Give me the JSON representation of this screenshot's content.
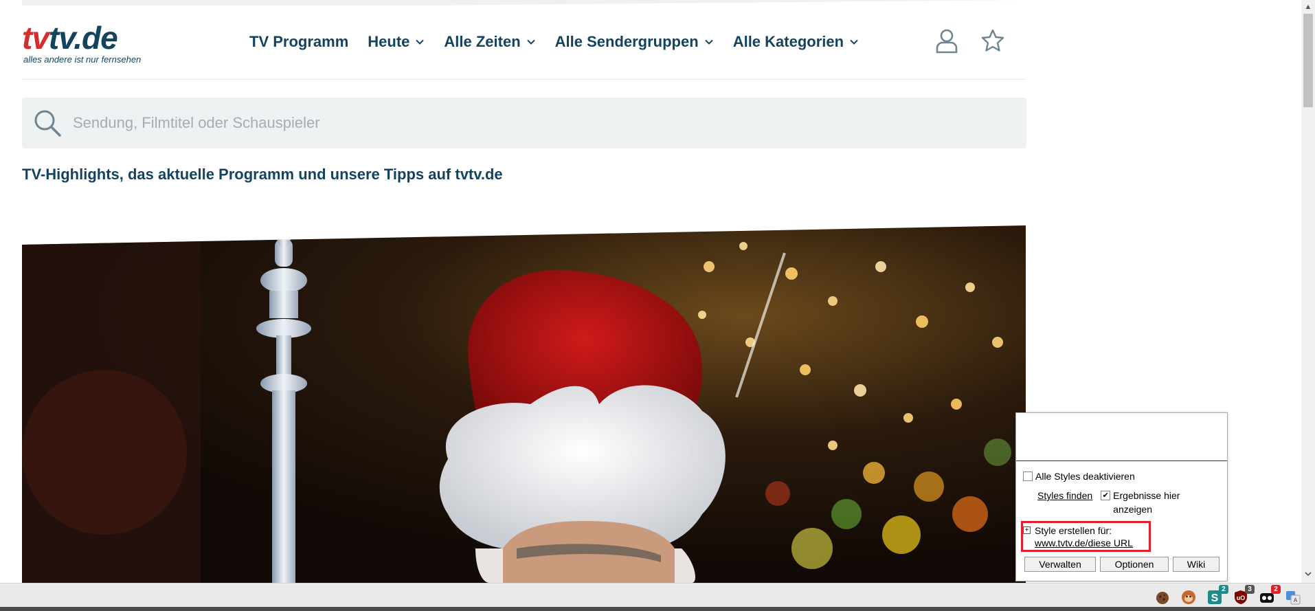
{
  "logo": {
    "part1": "tv",
    "part2": "tv.de",
    "tagline": "alles andere ist nur fernsehen"
  },
  "nav": {
    "items": [
      {
        "label": "TV Programm",
        "dropdown": false
      },
      {
        "label": "Heute",
        "dropdown": true
      },
      {
        "label": "Alle Zeiten",
        "dropdown": true
      },
      {
        "label": "Alle Sendergruppen",
        "dropdown": true
      },
      {
        "label": "Alle Kategorien",
        "dropdown": true
      }
    ]
  },
  "header_icons": {
    "account": "user-icon",
    "favorites": "star-icon"
  },
  "search": {
    "placeholder": "Sendung, Filmtitel oder Schauspieler",
    "value": ""
  },
  "page": {
    "title": "TV-Highlights, das aktuelle Programm und unsere Tipps auf tvtv.de"
  },
  "popup": {
    "disable_all": "Alle Styles deaktivieren",
    "find_styles": "Styles finden",
    "show_results_here": "Ergebnisse hier anzeigen",
    "create_style_for": "Style erstellen für:",
    "create_style_url": "www.tvtv.de/diese URL",
    "buttons": {
      "manage": "Verwalten",
      "options": "Optionen",
      "wiki": "Wiki"
    },
    "disable_all_checked": false,
    "show_results_checked": true
  },
  "extensions": {
    "stylish_badge": "2",
    "ublock_badge": "3",
    "other_badge": "2"
  },
  "colors": {
    "brand_red": "#d32f2f",
    "brand_navy": "#14435e",
    "search_bg": "#eef1f2",
    "highlight_red": "#e0202c"
  }
}
